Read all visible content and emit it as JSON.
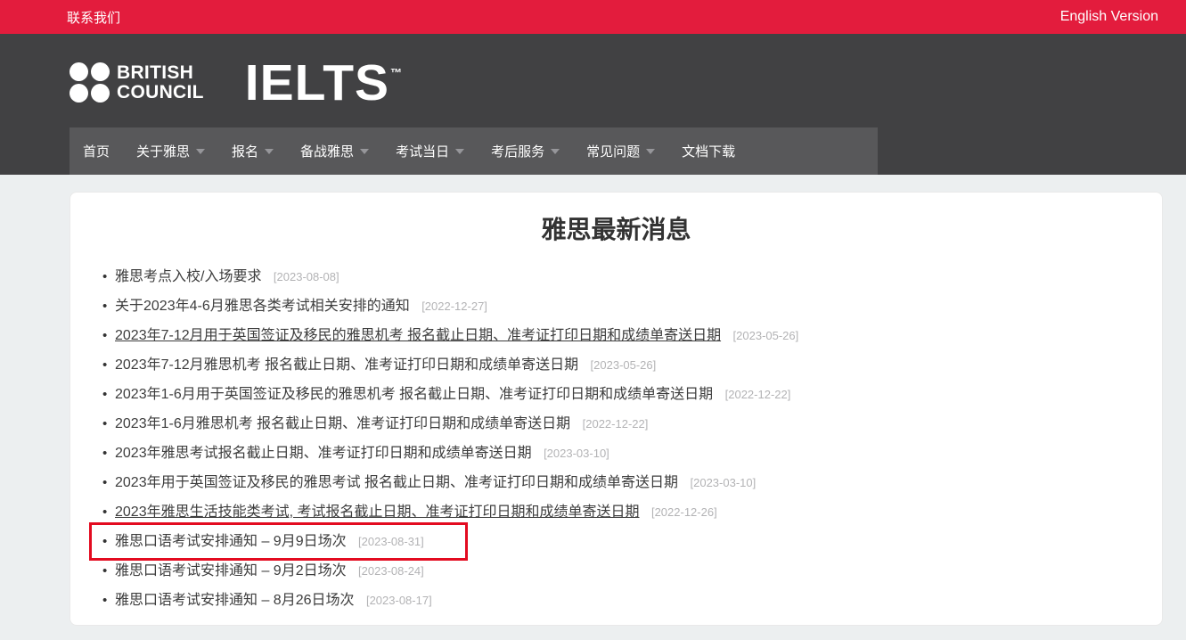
{
  "topbar": {
    "contact_label": "联系我们",
    "english_label": "English Version"
  },
  "header": {
    "brand_line1": "BRITISH",
    "brand_line2": "COUNCIL",
    "brand_ielts": "IELTS",
    "trademark": "™"
  },
  "nav": {
    "items": [
      {
        "label": "首页",
        "has_dropdown": false
      },
      {
        "label": "关于雅思",
        "has_dropdown": true
      },
      {
        "label": "报名",
        "has_dropdown": true
      },
      {
        "label": "备战雅思",
        "has_dropdown": true
      },
      {
        "label": "考试当日",
        "has_dropdown": true
      },
      {
        "label": "考后服务",
        "has_dropdown": true
      },
      {
        "label": "常见问题",
        "has_dropdown": true
      },
      {
        "label": "文档下载",
        "has_dropdown": false
      }
    ]
  },
  "main": {
    "title": "雅思最新消息",
    "bullet_glyph": "•",
    "news": [
      {
        "text": "雅思考点入校/入场要求",
        "date": "[2023-08-08]",
        "underlined": false,
        "highlighted": false
      },
      {
        "text": "关于2023年4-6月雅思各类考试相关安排的通知",
        "date": "[2022-12-27]",
        "underlined": false,
        "highlighted": false
      },
      {
        "text": "2023年7-12月用于英国签证及移民的雅思机考 报名截止日期、准考证打印日期和成绩单寄送日期",
        "date": "[2023-05-26]",
        "underlined": true,
        "highlighted": false
      },
      {
        "text": "2023年7-12月雅思机考 报名截止日期、准考证打印日期和成绩单寄送日期",
        "date": "[2023-05-26]",
        "underlined": false,
        "highlighted": false
      },
      {
        "text": "2023年1-6月用于英国签证及移民的雅思机考 报名截止日期、准考证打印日期和成绩单寄送日期",
        "date": "[2022-12-22]",
        "underlined": false,
        "highlighted": false
      },
      {
        "text": "2023年1-6月雅思机考 报名截止日期、准考证打印日期和成绩单寄送日期",
        "date": "[2022-12-22]",
        "underlined": false,
        "highlighted": false
      },
      {
        "text": "2023年雅思考试报名截止日期、准考证打印日期和成绩单寄送日期",
        "date": "[2023-03-10]",
        "underlined": false,
        "highlighted": false
      },
      {
        "text": "2023年用于英国签证及移民的雅思考试 报名截止日期、准考证打印日期和成绩单寄送日期",
        "date": "[2023-03-10]",
        "underlined": false,
        "highlighted": false
      },
      {
        "text": "2023年雅思生活技能类考试, 考试报名截止日期、准考证打印日期和成绩单寄送日期",
        "date": "[2022-12-26]",
        "underlined": true,
        "highlighted": false
      },
      {
        "text": "雅思口语考试安排通知 – 9月9日场次",
        "date": "[2023-08-31]",
        "underlined": false,
        "highlighted": true
      },
      {
        "text": "雅思口语考试安排通知 – 9月2日场次",
        "date": "[2023-08-24]",
        "underlined": false,
        "highlighted": false
      },
      {
        "text": "雅思口语考试安排通知 – 8月26日场次",
        "date": "[2023-08-17]",
        "underlined": false,
        "highlighted": false
      }
    ]
  },
  "colors": {
    "topbar_bg": "#e31c3d",
    "header_bg": "#414143",
    "nav_bg": "#58585a",
    "page_bg": "#eceff0",
    "card_bg": "#ffffff",
    "text": "#3d3d3d",
    "date": "#b3b3b5",
    "highlight_border": "#e30b20"
  }
}
